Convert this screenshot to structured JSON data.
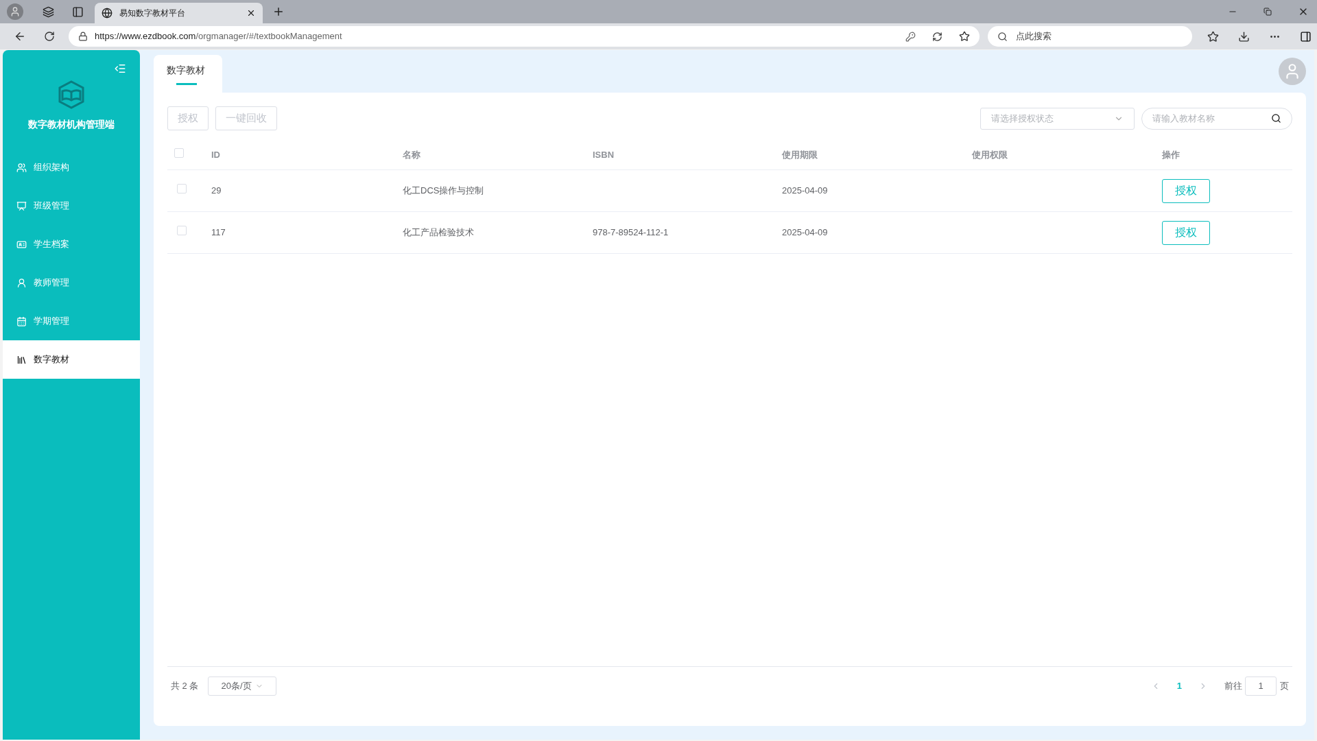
{
  "browser": {
    "tab_title": "易知数字教材平台",
    "url_host": "https://www.ezdbook.com",
    "url_path": "/orgmanager/#/textbookManagement",
    "search_placeholder": "点此搜索"
  },
  "sidebar": {
    "title": "数字教材机构管理端",
    "items": [
      {
        "label": "组织架构",
        "selected": false
      },
      {
        "label": "班级管理",
        "selected": false
      },
      {
        "label": "学生档案",
        "selected": false
      },
      {
        "label": "教师管理",
        "selected": false
      },
      {
        "label": "学期管理",
        "selected": false
      },
      {
        "label": "数字教材",
        "selected": true
      }
    ]
  },
  "page_tabs": [
    {
      "label": "数字教材",
      "selected": true
    }
  ],
  "toolbar": {
    "buttons": [
      {
        "label": "授权",
        "disabled": true
      },
      {
        "label": "一键回收",
        "disabled": true
      }
    ],
    "status_select": {
      "placeholder": "请选择授权状态"
    },
    "search": {
      "placeholder": "请输入教材名称"
    }
  },
  "table": {
    "columns": [
      "ID",
      "名称",
      "ISBN",
      "使用期限",
      "使用权限",
      "操作"
    ],
    "header_checked": false,
    "rows": [
      {
        "checked": false,
        "id": "29",
        "name": "化工DCS操作与控制",
        "expiry": "2025-04-09",
        "action": "授权"
      },
      {
        "checked": false,
        "id": "117",
        "name": "化工产品检验技术",
        "isbn": "978-7-89524-112-1",
        "expiry": "2025-04-09",
        "action": "授权"
      }
    ]
  },
  "pagination": {
    "total": "共 2 条",
    "page_size": "20条/页",
    "pages": [
      {
        "label": "1",
        "selected": true
      }
    ],
    "goto_label": "前往",
    "goto_value": "1",
    "goto_suffix": "页"
  }
}
